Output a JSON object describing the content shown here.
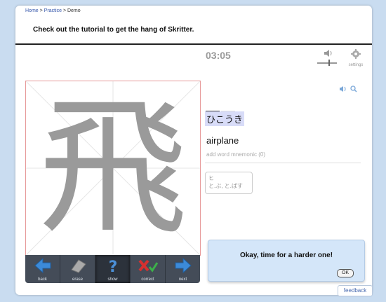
{
  "breadcrumb": {
    "home": "Home",
    "practice": "Practice",
    "current": "Demo",
    "sep": ">"
  },
  "instruction": "Check out the tutorial to get the hang of Skritter.",
  "timer": "03:05",
  "settings_label": "settings",
  "kanji": "飛",
  "reading": "ひこうき",
  "definition": "airplane",
  "mnemonic": "add word mnemonic (0)",
  "components": {
    "kana": "ヒ",
    "kun": "と.ぶ, と.ばす"
  },
  "toolbar": {
    "back": "back",
    "erase": "erase",
    "show": "show",
    "correct": "correct",
    "next": "next"
  },
  "popup": {
    "message": "Okay, time for a harder one!",
    "ok": "OK"
  },
  "feedback": "feedback",
  "colors": {
    "accent_blue": "#3c8ad8",
    "toolbar_bg": "#444c58",
    "kanji_gray": "#9a9a9a",
    "popup_bg": "#d4e6f9"
  },
  "icons": [
    "volume-icon",
    "settings-gear-icon",
    "speaker-icon",
    "magnifier-icon",
    "back-arrow-icon",
    "eraser-icon",
    "question-icon",
    "correct-icon",
    "next-arrow-icon"
  ]
}
